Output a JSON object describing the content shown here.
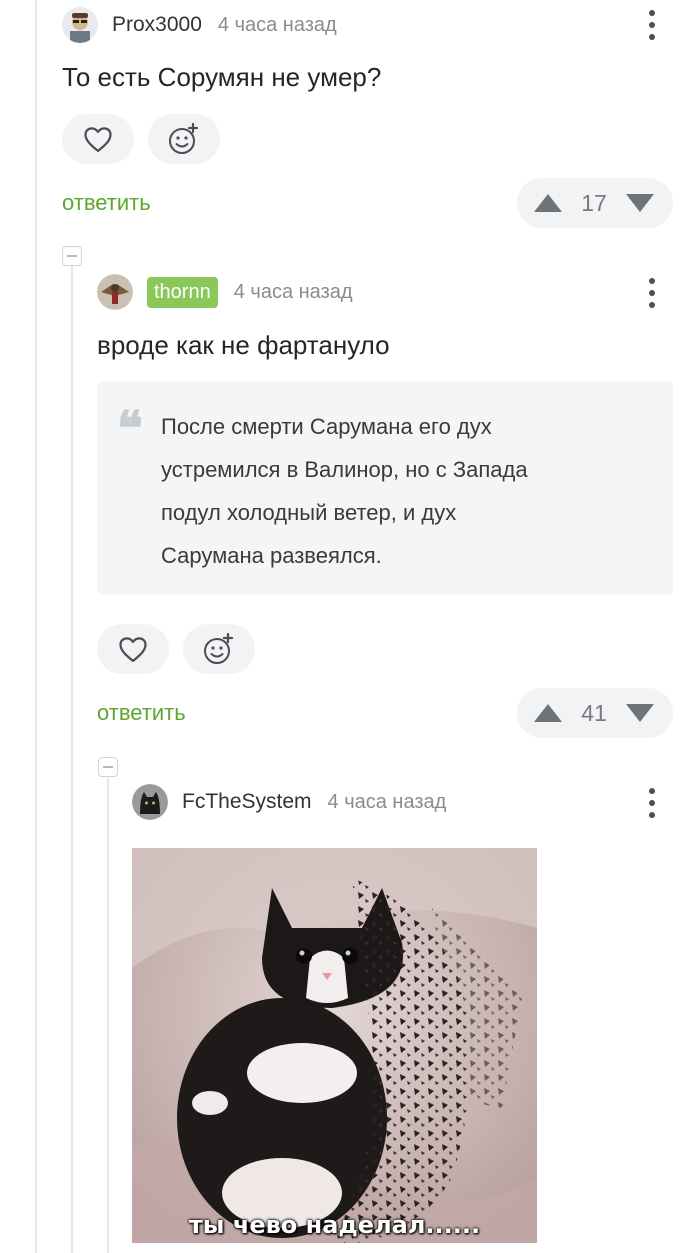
{
  "comments": [
    {
      "username": "Prox3000",
      "time": "4 часа назад",
      "text": "То есть Сорумян не умер?",
      "reply_label": "ответить",
      "rating": "17"
    },
    {
      "username": "thornn",
      "time": "4 часа назад",
      "text": "вроде как не фартануло",
      "quote_lines": [
        "После смерти Сарумана его дух",
        "устремился в Валинор, но с Запада",
        "подул холодный ветер, и дух",
        "Сарумана развеялся."
      ],
      "reply_label": "ответить",
      "rating": "41"
    },
    {
      "username": "FcTheSystem",
      "time": "4 часа назад",
      "image_caption": "ты чево наделал......"
    }
  ],
  "icons": {
    "like": "heart-icon",
    "react": "smile-plus-icon",
    "upvote": "triangle-up-icon",
    "downvote": "triangle-down-icon",
    "menu": "kebab-menu-icon",
    "collapse": "collapse-minus-icon"
  },
  "colors": {
    "accent_green": "#5ea62f",
    "tag_green": "#8ac858",
    "button_bg": "#f2f3f5",
    "quote_bg": "#f4f5f7"
  }
}
